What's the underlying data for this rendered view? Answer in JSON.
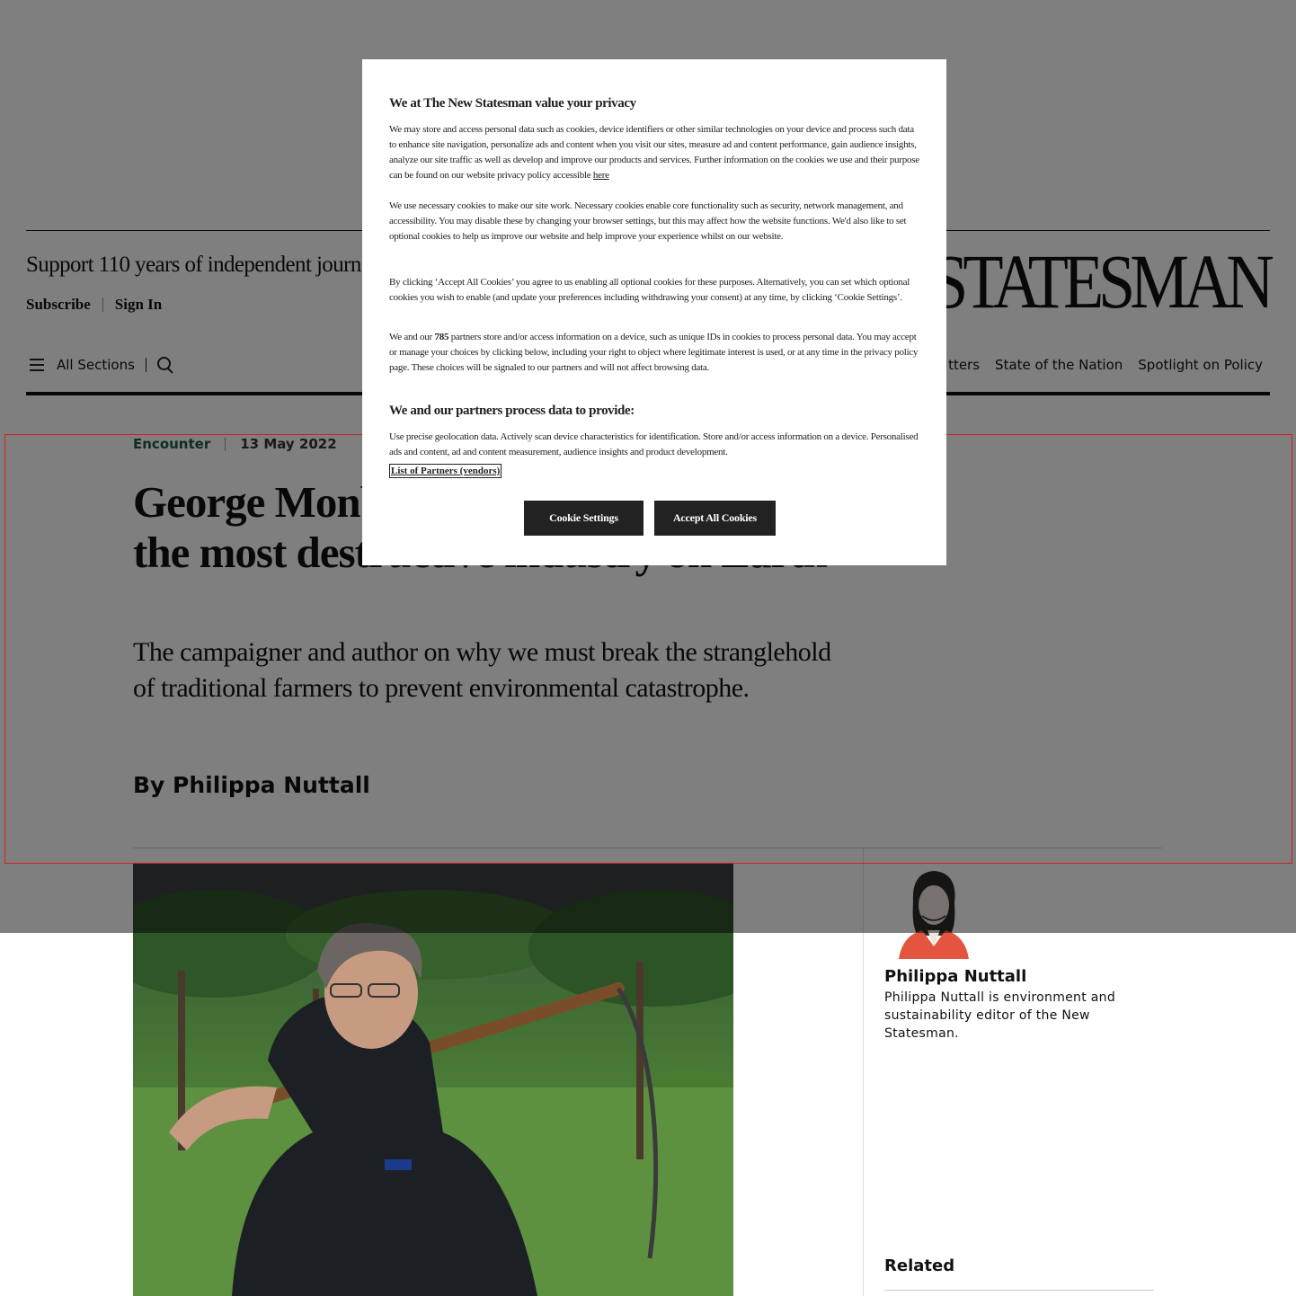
{
  "header": {
    "support_text": "Support 110 years of independent journ",
    "subscribe_label": "Subscribe",
    "sign_in_label": "Sign In",
    "masthead": "W STATESMAN",
    "all_sections_label": "All Sections",
    "nav_items": [
      "tters",
      "State of the Nation",
      "Spotlight on Policy"
    ]
  },
  "article": {
    "section": "Encounter",
    "date": "13 May 2022",
    "headline": "George Monbiot: “Farming is arguably the most destructive industry on Earth”",
    "standfirst": "The campaigner and author on why we must break the stranglehold of traditional farmers to prevent environmental catastrophe.",
    "byline": "By Philippa Nuttall"
  },
  "sidebar": {
    "author_name": "Philippa Nuttall",
    "author_bio": "Philippa Nuttall is environment and sustainability editor of the New Statesman.",
    "related_heading": "Related"
  },
  "modal": {
    "title": "We at The New Statesman value your privacy",
    "p1": "We may store and access personal data such as cookies, device identifiers or other similar technologies on your device and process such data to enhance site navigation, personalize ads and content when you visit our sites, measure ad and content performance, gain audience insights, analyze our site traffic as well as develop and improve our products and services. Further information on the cookies we use and their purpose can be found on our website privacy policy accessible",
    "p1_link": "here",
    "p2": "We use necessary cookies to make our site work. Necessary cookies enable core functionality such as security, network management, and accessibility. You may disable these by changing your browser settings, but this may affect how the website functions. We'd also like to set optional cookies to help us improve our website and help improve your experience whilst on our website.",
    "p3": "By clicking ‘Accept All Cookies’ you agree to us enabling all optional cookies for these purposes. Alternatively, you can set which optional cookies you wish to enable (and update your preferences including withdrawing your consent) at any time, by clicking ‘Cookie Settings’.",
    "p4_prefix": "We and our",
    "p4_count": "785",
    "p4_suffix": "partners store and/or access information on a device, such as unique IDs in cookies to process personal data. You may accept or manage your choices by clicking below, including your right to object where legitimate interest is used, or at any time in the privacy policy page. These choices will be signaled to our partners and will not affect browsing data.",
    "subtitle": "We and our partners process data to provide:",
    "p5": "Use precise geolocation data. Actively scan device characteristics for identification. Store and/or access information on a device. Personalised ads and content, ad and content measurement, audience insights and product development.",
    "partners_link": "List of Partners (vendors)",
    "cookie_settings_label": "Cookie Settings",
    "accept_all_label": "Accept All Cookies"
  }
}
